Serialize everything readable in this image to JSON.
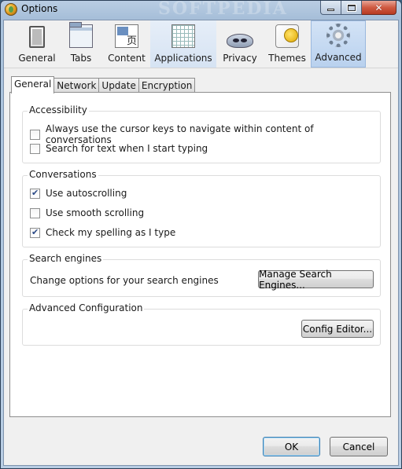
{
  "window": {
    "title": "Options",
    "watermark": "SOFTPEDIA"
  },
  "window_buttons": {
    "minimize": "minimize",
    "maximize": "maximize",
    "close": "✕"
  },
  "toolbar": {
    "panes": [
      {
        "label": "General",
        "icon": "general-icon"
      },
      {
        "label": "Tabs",
        "icon": "tabs-icon"
      },
      {
        "label": "Content",
        "icon": "content-icon"
      },
      {
        "label": "Applications",
        "icon": "applications-icon"
      },
      {
        "label": "Privacy",
        "icon": "privacy-mask-icon"
      },
      {
        "label": "Themes",
        "icon": "themes-icon"
      },
      {
        "label": "Advanced",
        "icon": "gear-icon",
        "selected": true
      }
    ]
  },
  "tabs": [
    {
      "label": "General",
      "active": true
    },
    {
      "label": "Network"
    },
    {
      "label": "Update"
    },
    {
      "label": "Encryption"
    }
  ],
  "accessibility": {
    "heading": "Accessibility",
    "cursor_keys": {
      "label": "Always use the cursor keys to navigate within content of conversations",
      "checked": false
    },
    "search_typing": {
      "label": "Search for text when I start typing",
      "checked": false
    }
  },
  "conversations": {
    "heading": "Conversations",
    "autoscrolling": {
      "label": "Use autoscrolling",
      "checked": true
    },
    "smooth_scrolling": {
      "label": "Use smooth scrolling",
      "checked": false
    },
    "spelling": {
      "label": "Check my spelling as I type",
      "checked": true
    }
  },
  "search_engines": {
    "heading": "Search engines",
    "description": "Change options for your search engines",
    "button": "Manage Search Engines..."
  },
  "advanced_config": {
    "heading": "Advanced Configuration",
    "button": "Config Editor..."
  },
  "footer": {
    "ok": "OK",
    "cancel": "Cancel"
  },
  "colors": {
    "selected_pane": "#b9d1ee",
    "default_button_border": "#3c7fb1",
    "checkmark": "#2b4a87"
  }
}
